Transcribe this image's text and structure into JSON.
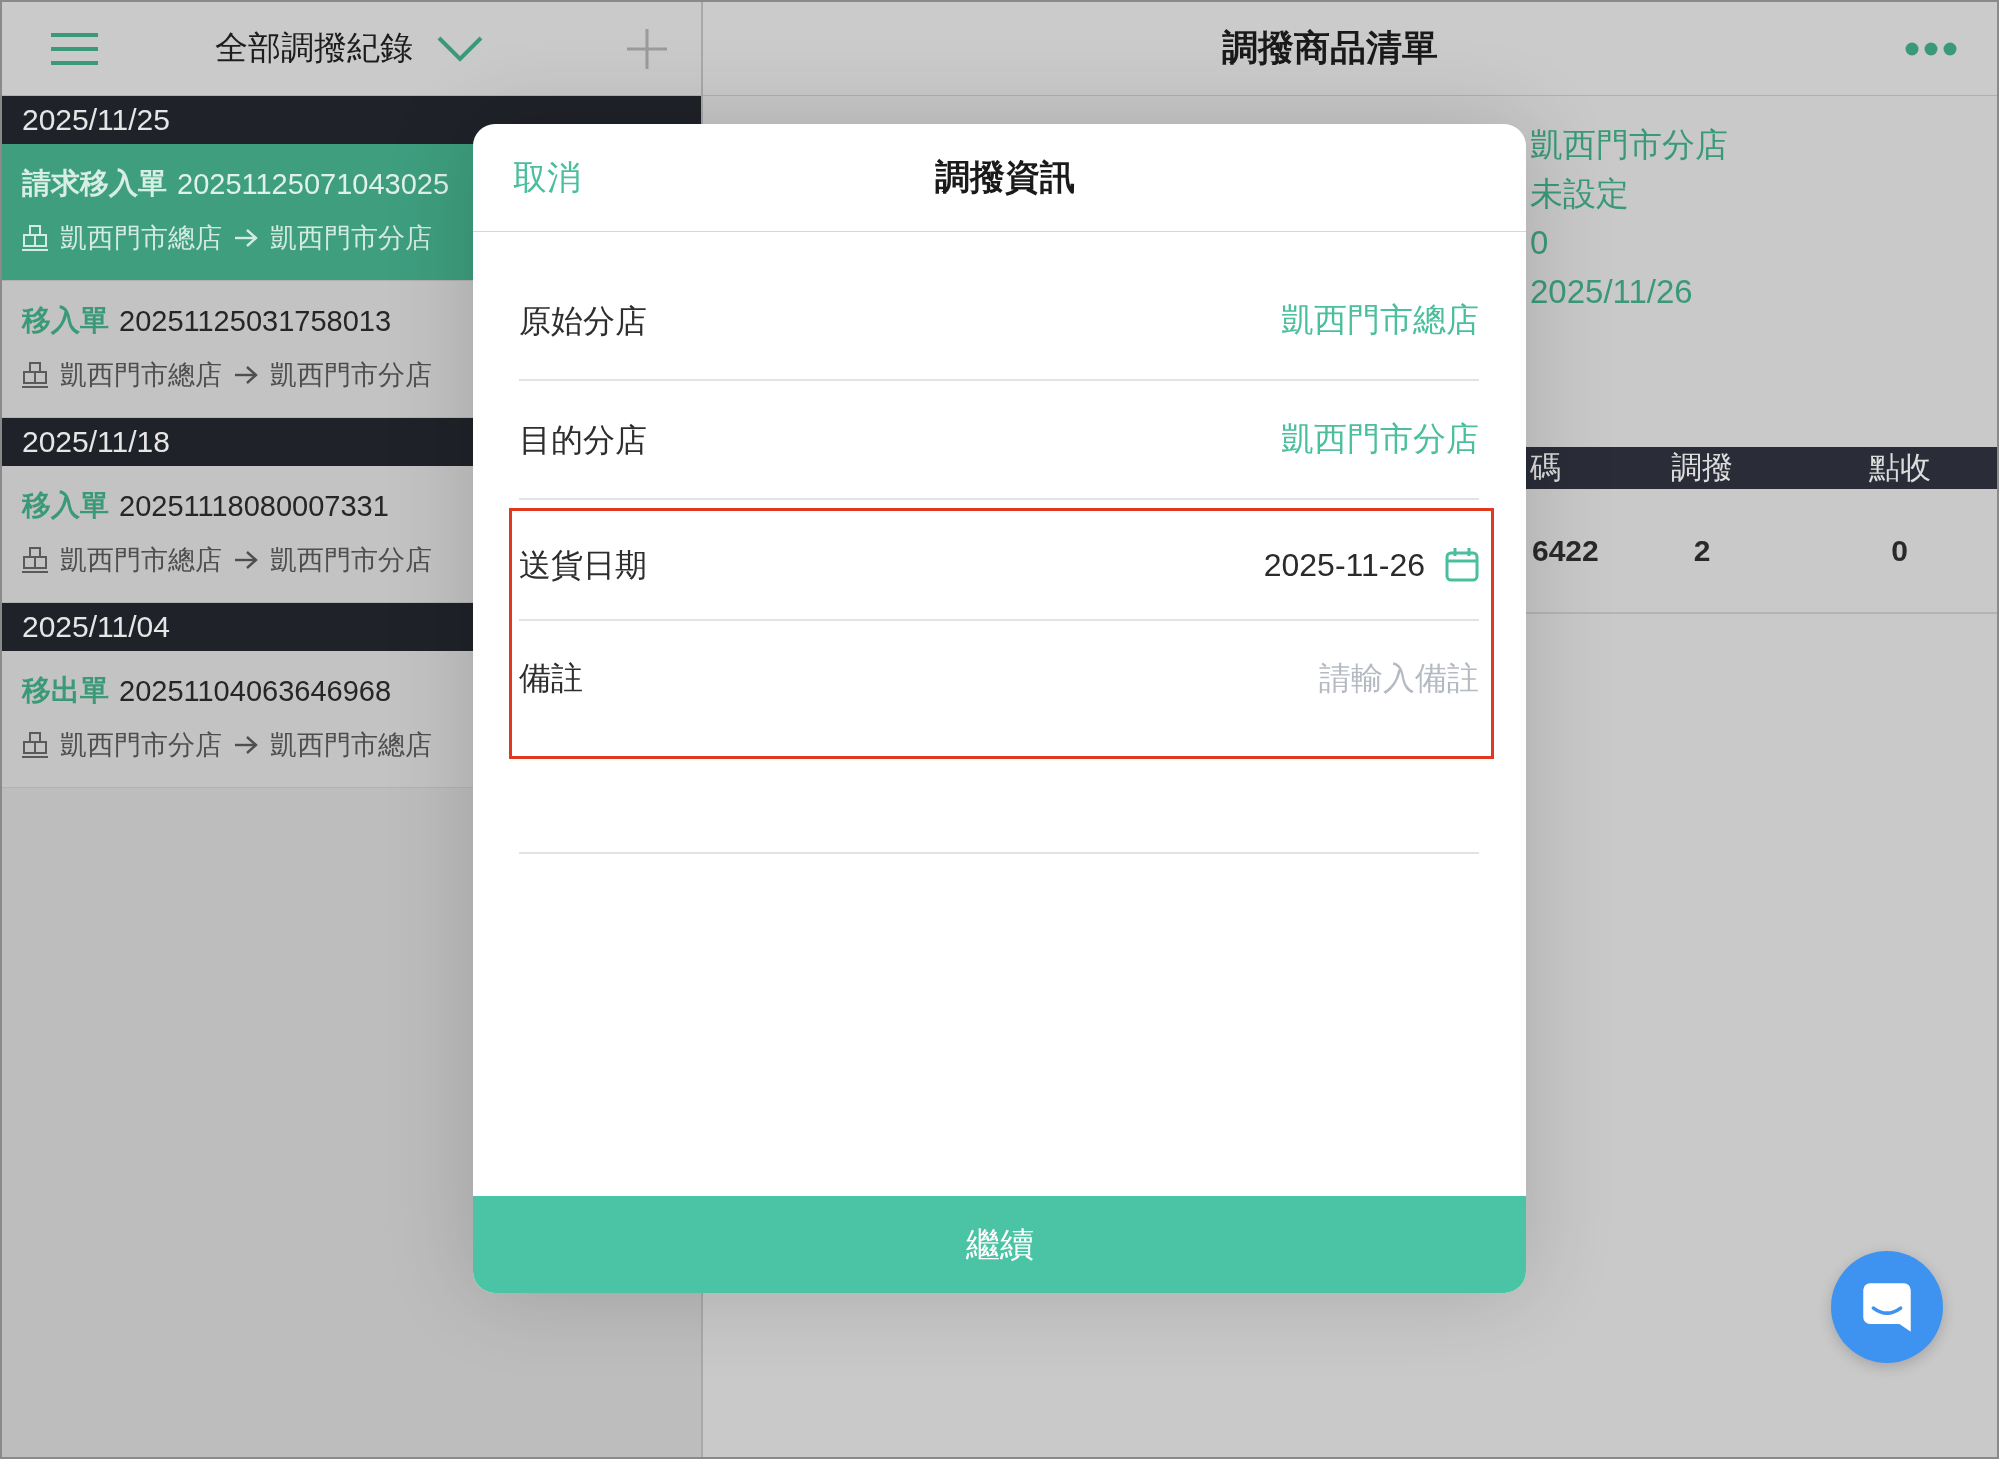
{
  "records_header": {
    "title": "全部調撥紀錄"
  },
  "record_groups": [
    {
      "date": "2025/11/25",
      "records": [
        {
          "type": "請求移入單",
          "number": "20251125071043025",
          "from": "凱西門市總店",
          "to": "凱西門市分店",
          "selected": true
        },
        {
          "type": "移入單",
          "number": "20251125031758013",
          "from": "凱西門市總店",
          "to": "凱西門市分店",
          "selected": false
        }
      ]
    },
    {
      "date": "2025/11/18",
      "records": [
        {
          "type": "移入單",
          "number": "20251118080007331",
          "from": "凱西門市總店",
          "to": "凱西門市分店",
          "selected": false
        }
      ]
    },
    {
      "date": "2025/11/04",
      "records": [
        {
          "type": "移出單",
          "number": "20251104063646968",
          "from": "凱西門市分店",
          "to": "凱西門市總店",
          "selected": false
        }
      ]
    }
  ],
  "main_header": {
    "title": "調撥商品清單"
  },
  "details": [
    "凱西門市分店",
    "未設定",
    "0",
    "2025/11/26"
  ],
  "table": {
    "columns": [
      "碼",
      "調撥",
      "點收"
    ],
    "rows": [
      [
        "6422",
        "2",
        "0"
      ]
    ]
  },
  "dialog": {
    "cancel": "取消",
    "title": "調撥資訊",
    "fields": [
      {
        "kind": "value",
        "label": "原始分店",
        "value": "凱西門市總店",
        "highlighted": false
      },
      {
        "kind": "value",
        "label": "目的分店",
        "value": "凱西門市分店",
        "highlighted": false
      },
      {
        "kind": "date",
        "label": "送貨日期",
        "value": "2025-11-26",
        "highlighted": true
      },
      {
        "kind": "text",
        "label": "備註",
        "placeholder": "請輸入備註",
        "highlighted": true
      }
    ],
    "confirm": "繼續"
  }
}
